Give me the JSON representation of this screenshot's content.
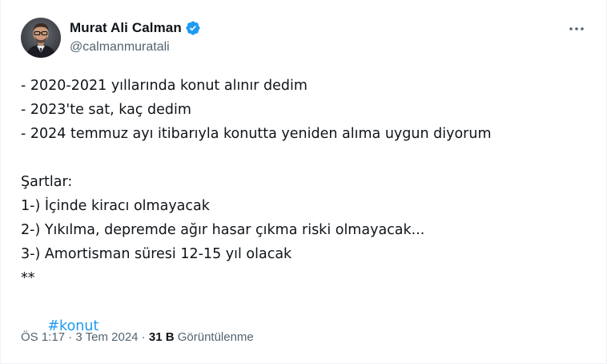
{
  "author": {
    "display_name": "Murat Ali Calman",
    "handle": "@calmanmuratali",
    "avatar_icon": "profile-photo",
    "verified_icon": "verified-badge-icon",
    "verified_color": "#1d9bf0"
  },
  "more_icon": "more-horizontal-icon",
  "tweet": {
    "lines": [
      "- 2020-2021 yıllarında konut alınır dedim",
      "- 2023'te sat, kaç dedim",
      "- 2024 temmuz ayı itibarıyla konutta yeniden alıma uygun diyorum",
      "",
      "Şartlar:",
      "1-) İçinde kiracı olmayacak",
      "2-) Yıkılma, depremde ağır hasar çıkma riski olmayacak...",
      "3-) Amortisman süresi 12-15 yıl olacak",
      "**"
    ],
    "hashtag": "#konut",
    "hashtag_color": "#1d9bf0"
  },
  "meta": {
    "time": "ÖS 1:17",
    "separator": " · ",
    "date": "3 Tem 2024",
    "views_count": "31 B",
    "views_label": "Görüntülenme"
  }
}
